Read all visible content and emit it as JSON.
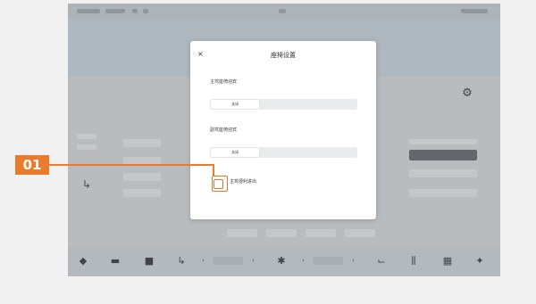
{
  "callout": {
    "label": "01",
    "color": "#ea7a2c"
  },
  "dialog": {
    "title": "座椅设置",
    "close_icon": "close-icon",
    "section1": {
      "title": "主驾座椅迎宾",
      "subtitle": "",
      "options": [
        "关闭",
        "",
        ""
      ],
      "selected_index": 0
    },
    "section2": {
      "title": "副驾座椅迎宾",
      "subtitle": "",
      "options": [
        "关闭",
        "",
        ""
      ],
      "selected_index": 0
    },
    "checkbox": {
      "label": "主驾便利进出",
      "checked": false,
      "accent_color": "#e8742b"
    }
  },
  "background": {
    "seat_label": "",
    "settings_icon": "gear-icon",
    "dock_icons": [
      "car-icon",
      "bus-icon",
      "home-icon",
      "seat-icon",
      "fan-icon",
      "seat-heat-icon",
      "seat-vent-icon",
      "rear-icon",
      "settings-icon"
    ]
  }
}
